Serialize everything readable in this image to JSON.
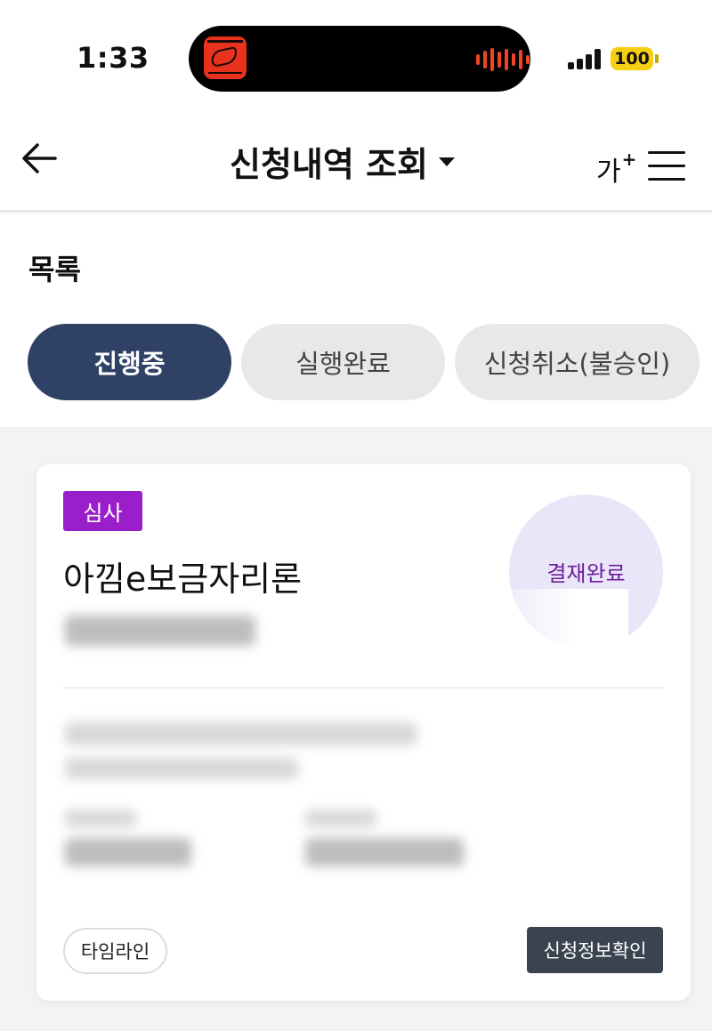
{
  "status_bar": {
    "time": "1:33",
    "battery": "100",
    "album_art_icon": "album-art-icon",
    "waveform_icon": "audio-waveform-icon",
    "signal_icon": "cellular-signal-icon"
  },
  "header": {
    "title": "신청내역 조회",
    "font_size_label": "가",
    "font_size_plus": "+",
    "back_icon": "arrow-left-icon",
    "dropdown_icon": "caret-down-icon",
    "menu_icon": "hamburger-menu-icon"
  },
  "list": {
    "title": "목록",
    "tabs": [
      {
        "label": "진행중",
        "selected": true
      },
      {
        "label": "실행완료",
        "selected": false
      },
      {
        "label": "신청취소(불승인)",
        "selected": false
      }
    ]
  },
  "card": {
    "badge": "심사",
    "product_name": "아낌e보금자리론",
    "status": "결재완료",
    "timeline_button": "타임라인",
    "detail_button": "신청정보확인"
  },
  "colors": {
    "tab_active": "#2f4266",
    "badge": "#9a1ec9",
    "status_text": "#6e1f9b",
    "status_circle": "#e8e6f8",
    "battery": "#f7cf12",
    "detail_button": "#3a4450"
  }
}
